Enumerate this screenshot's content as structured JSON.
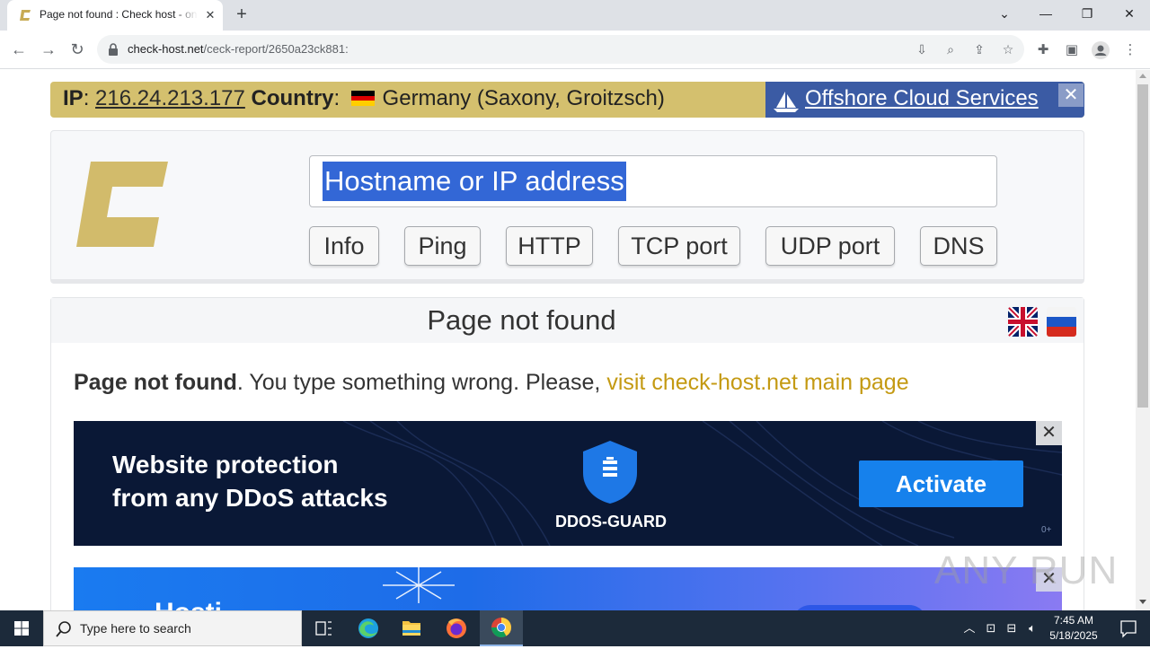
{
  "browser": {
    "tab_title": "Page not found : Check host - online website monitoring",
    "tab_close": "✕",
    "new_tab": "+",
    "window": {
      "minimize": "—",
      "maximize": "❐",
      "close": "✕",
      "tablist": "⌄"
    },
    "url_host": "check-host.net",
    "url_path": "/ceck-report/2650a23ck881:"
  },
  "ipbar": {
    "ip_label": "IP",
    "ip_value": "216.24.213.177",
    "country_label": "Country",
    "country_value": "Germany (Saxony, Groitzsch)",
    "flag_colors": [
      "#000000",
      "#dd0000",
      "#ffce00"
    ],
    "offshore_link": "Offshore Cloud Services",
    "close": "✕"
  },
  "search": {
    "placeholder": "Hostname or IP address",
    "buttons": [
      "Info",
      "Ping",
      "HTTP",
      "TCP port",
      "UDP port",
      "DNS"
    ]
  },
  "result": {
    "heading": "Page not found",
    "message_bold": "Page not found",
    "message_text": ". You type something wrong. Please, ",
    "message_link": "visit check-host.net main page"
  },
  "ad": {
    "line1": "Website protection",
    "line2": "from any DDoS attacks",
    "brand": "DDOS-GUARD",
    "cta": "Activate",
    "age": "0+",
    "close": "✕"
  },
  "ad2": {
    "text": "Hosti",
    "close": "✕"
  },
  "watermark": "ANY RUN",
  "taskbar": {
    "search_placeholder": "Type here to search",
    "time": "7:45 AM",
    "date": "5/18/2025"
  },
  "colors": {
    "brand_gold": "#d4c06e",
    "offshore_blue": "#3b5ba4",
    "link_gold": "#c49a13",
    "selection": "#3367d6"
  }
}
